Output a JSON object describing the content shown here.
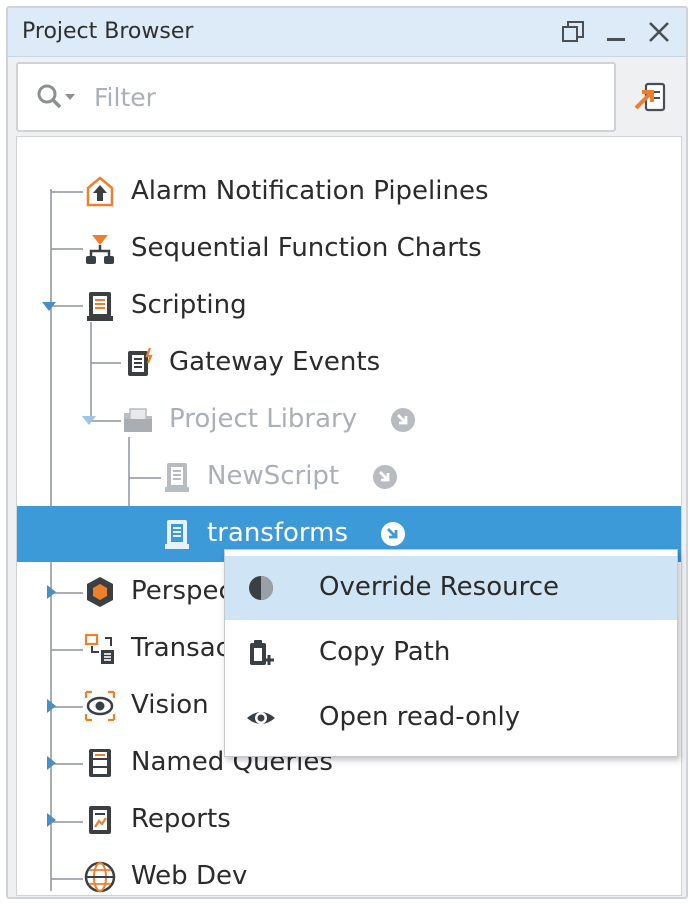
{
  "panel": {
    "title": "Project Browser",
    "filter_placeholder": "Filter"
  },
  "tree": {
    "items": [
      {
        "label": "Alarm Notification Pipelines",
        "icon": "alarm-pipeline-icon"
      },
      {
        "label": "Sequential Function Charts",
        "icon": "sfc-icon"
      },
      {
        "label": "Scripting",
        "icon": "scripting-icon",
        "expanded": true
      },
      {
        "label": "Gateway Events",
        "icon": "gateway-events-icon"
      },
      {
        "label": "Project Library",
        "icon": "folder-icon",
        "expanded": true,
        "inherited": true
      },
      {
        "label": "NewScript",
        "icon": "script-icon",
        "inherited": true
      },
      {
        "label": "transforms",
        "icon": "script-icon",
        "inherited": true,
        "selected": true
      },
      {
        "label": "Perspective",
        "icon": "perspective-icon"
      },
      {
        "label": "Transaction Groups",
        "icon": "transaction-icon"
      },
      {
        "label": "Vision",
        "icon": "vision-icon"
      },
      {
        "label": "Named Queries",
        "icon": "named-queries-icon"
      },
      {
        "label": "Reports",
        "icon": "reports-icon"
      },
      {
        "label": "Web Dev",
        "icon": "web-dev-icon"
      }
    ]
  },
  "context_menu": {
    "items": [
      {
        "label": "Override Resource",
        "icon": "override-icon"
      },
      {
        "label": "Copy Path",
        "icon": "copy-path-icon"
      },
      {
        "label": "Open read-only",
        "icon": "eye-icon"
      }
    ]
  },
  "colors": {
    "selection": "#3d9ad8",
    "titlebar": "#dcebf7",
    "menu_hover": "#cfe5f5",
    "accent_orange": "#f07f2a"
  }
}
